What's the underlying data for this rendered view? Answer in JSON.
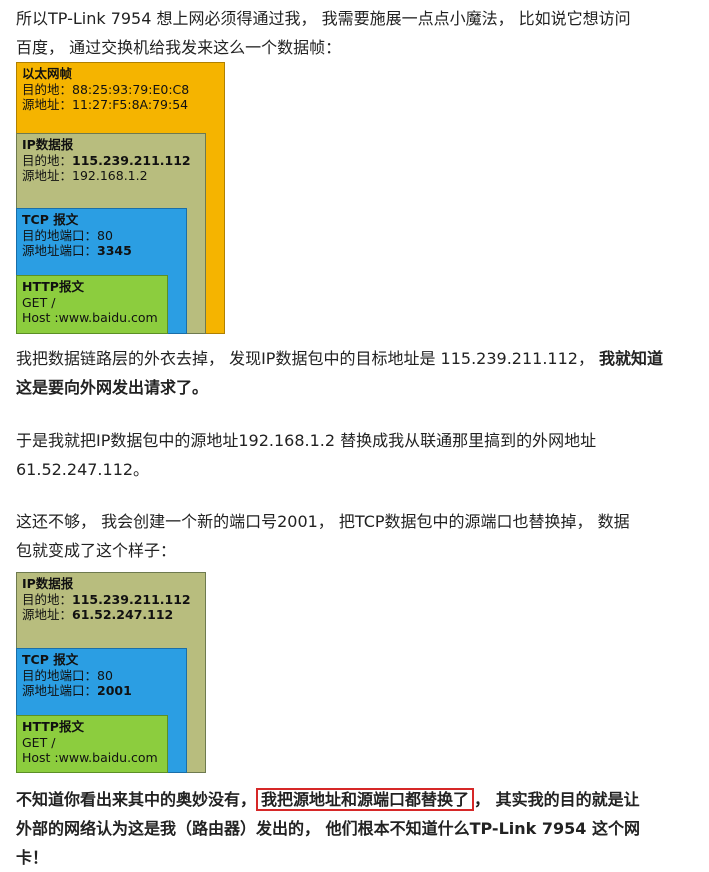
{
  "intro": {
    "line1": "所以TP-Link 7954 想上网必须得通过我， 我需要施展一点点小魔法， 比如说它想访问",
    "line2": "百度， 通过交换机给我发来这么一个数据帧："
  },
  "diagram1": {
    "ethernet": {
      "title": "以太网帧",
      "dst": "目的地：88:25:93:79:E0:C8",
      "src": "源地址：11:27:F5:8A:79:54"
    },
    "ip": {
      "title": "IP数据报",
      "dst_label": "目的地：",
      "dst_value": "115.239.211.112",
      "src": "源地址：192.168.1.2"
    },
    "tcp": {
      "title": "TCP 报文",
      "dst_port": "目的地端口：80",
      "src_port_label": "源地址端口：",
      "src_port_value": "3345"
    },
    "http": {
      "title": "HTTP报文",
      "line1": "GET /",
      "line2": "Host :www.baidu.com"
    }
  },
  "para2": {
    "line1_normal": "我把数据链路层的外衣去掉， 发现IP数据包中的目标地址是 115.239.211.112， ",
    "line1_bold": "我就知道",
    "line2_bold": "这是要向外网发出请求了。"
  },
  "para3": {
    "line1": "于是我就把IP数据包中的源地址192.168.1.2 替换成我从联通那里搞到的外网地址",
    "line2": "61.52.247.112。"
  },
  "para4": {
    "line1": "这还不够， 我会创建一个新的端口号2001， 把TCP数据包中的源端口也替换掉， 数据",
    "line2": "包就变成了这个样子："
  },
  "diagram2": {
    "ip": {
      "title": "IP数据报",
      "dst_label": "目的地：",
      "dst_value": "115.239.211.112",
      "src_label": "源地址：",
      "src_value": "61.52.247.112"
    },
    "tcp": {
      "title": "TCP 报文",
      "dst_port": "目的地端口：80",
      "src_port_label": "源地址端口：",
      "src_port_value": "2001"
    },
    "http": {
      "title": "HTTP报文",
      "line1": "GET /",
      "line2": "Host :www.baidu.com"
    }
  },
  "conclusion": {
    "line1_pre": "不知道你看出来其中的奥妙没有，",
    "line1_highlight": "我把源地址和源端口都替换了",
    "line1_post": "， 其实我的目的就是让",
    "line2": "外部的网络认为这是我（路由器）发出的， 他们根本不知道什么TP-Link 7954 这个网",
    "line3": "卡！"
  }
}
